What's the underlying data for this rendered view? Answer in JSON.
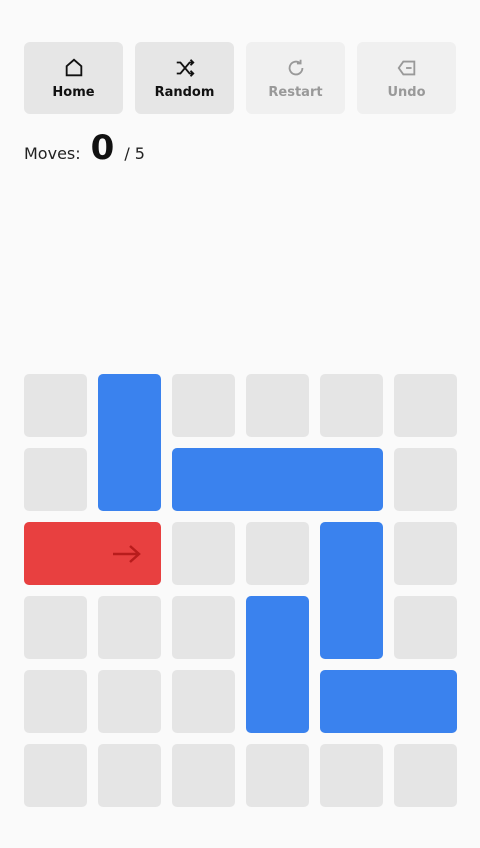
{
  "toolbar": {
    "buttons": [
      {
        "label": "Home",
        "icon": "home-icon",
        "enabled": true
      },
      {
        "label": "Random",
        "icon": "shuffle-icon",
        "enabled": true
      },
      {
        "label": "Restart",
        "icon": "restart-icon",
        "enabled": false
      },
      {
        "label": "Undo",
        "icon": "backspace-icon",
        "enabled": false
      }
    ]
  },
  "moves": {
    "label": "Moves:",
    "count": "0",
    "total": "/ 5"
  },
  "board": {
    "size": 6,
    "colors": {
      "cell": "#e5e5e5",
      "block": "#3a82ee",
      "target": "#e84040",
      "arrow": "#b81c1c"
    },
    "pieces": [
      {
        "row": 0,
        "col": 1,
        "length": 2,
        "orientation": "vertical",
        "type": "block"
      },
      {
        "row": 1,
        "col": 2,
        "length": 3,
        "orientation": "horizontal",
        "type": "block"
      },
      {
        "row": 2,
        "col": 0,
        "length": 2,
        "orientation": "horizontal",
        "type": "target",
        "icon": "arrow-right-icon"
      },
      {
        "row": 2,
        "col": 4,
        "length": 2,
        "orientation": "vertical",
        "type": "block"
      },
      {
        "row": 3,
        "col": 3,
        "length": 2,
        "orientation": "vertical",
        "type": "block"
      },
      {
        "row": 4,
        "col": 4,
        "length": 2,
        "orientation": "horizontal",
        "type": "block"
      }
    ]
  }
}
